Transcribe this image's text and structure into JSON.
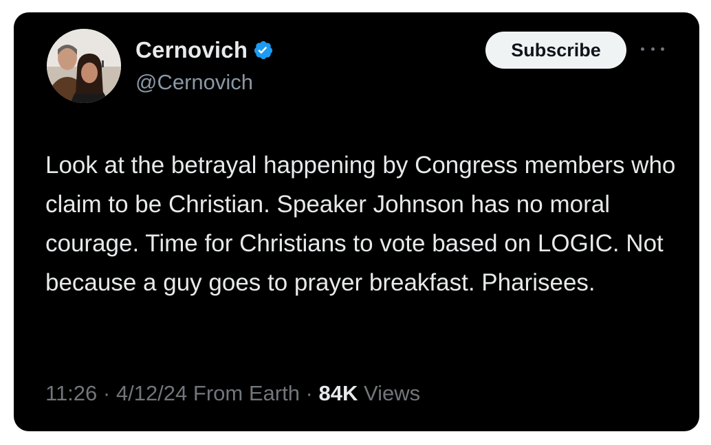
{
  "author": {
    "display_name": "Cernovich",
    "handle": "@Cernovich",
    "verified": true,
    "verified_color": "#1d9bf0"
  },
  "actions": {
    "subscribe_label": "Subscribe",
    "more_icon": "more-horizontal-icon"
  },
  "tweet": {
    "text": "Look at the betrayal happening by Congress members who claim to be Christian. Speaker Johnson has no moral courage. Time for Christians to vote based on LOGIC. Not because a guy goes to prayer breakfast. Pharisees."
  },
  "meta": {
    "time": "11:26",
    "separator": " · ",
    "date": "4/12/24",
    "source": "From Earth",
    "views_count": "84K",
    "views_label": "Views"
  }
}
